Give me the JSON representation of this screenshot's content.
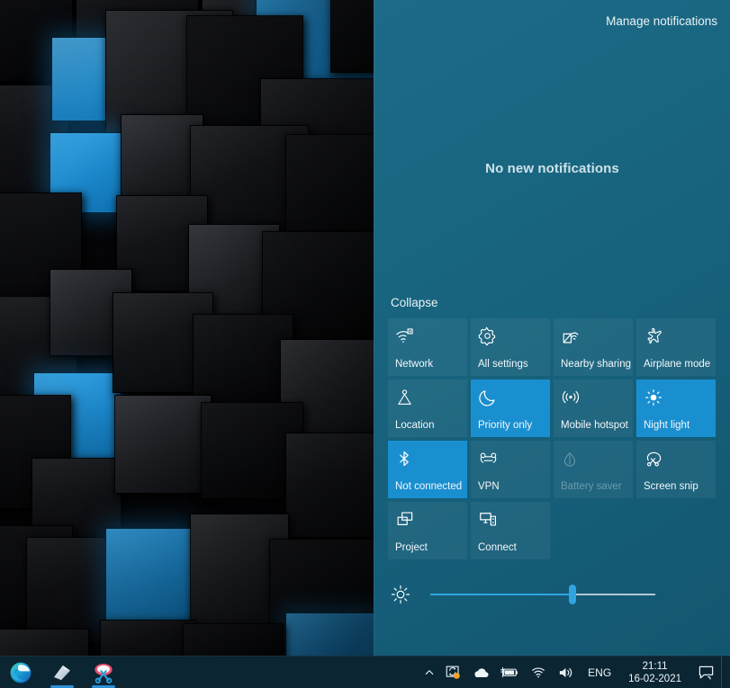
{
  "desktop": {
    "wallpaper_name": "dark-blue-cubes-wallpaper",
    "colors": {
      "cube_dark": "#131418",
      "cube_blue": "#1b86c9",
      "background": "#050507"
    }
  },
  "action_center": {
    "manage_notifications_label": "Manage notifications",
    "empty_state_text": "No new notifications",
    "collapse_label": "Collapse",
    "colors": {
      "panel_background": "#18657f",
      "tile_inactive": "#2d6d86",
      "tile_active_accent": "#1a8fd0",
      "text": "#f2f8fb"
    },
    "tiles": [
      {
        "label": "Network",
        "icon": "network-wifi-icon",
        "state": "off"
      },
      {
        "label": "All settings",
        "icon": "gear-icon",
        "state": "off"
      },
      {
        "label": "Nearby sharing",
        "icon": "nearby-sharing-icon",
        "state": "off"
      },
      {
        "label": "Airplane mode",
        "icon": "airplane-icon",
        "state": "off"
      },
      {
        "label": "Location",
        "icon": "location-icon",
        "state": "off"
      },
      {
        "label": "Priority only",
        "icon": "moon-icon",
        "state": "on"
      },
      {
        "label": "Mobile hotspot",
        "icon": "hotspot-icon",
        "state": "off"
      },
      {
        "label": "Night light",
        "icon": "night-light-sun-icon",
        "state": "on"
      },
      {
        "label": "Not connected",
        "icon": "bluetooth-icon",
        "state": "on"
      },
      {
        "label": "VPN",
        "icon": "vpn-icon",
        "state": "off"
      },
      {
        "label": "Battery saver",
        "icon": "battery-saver-icon",
        "state": "disabled"
      },
      {
        "label": "Screen snip",
        "icon": "screen-snip-icon",
        "state": "off"
      },
      {
        "label": "Project",
        "icon": "project-icon",
        "state": "off"
      },
      {
        "label": "Connect",
        "icon": "connect-icon",
        "state": "off"
      }
    ],
    "brightness": {
      "icon": "brightness-sun-icon",
      "value_percent": 63,
      "min": 0,
      "max": 100
    }
  },
  "taskbar": {
    "apps": [
      {
        "name": "microsoft-edge",
        "icon": "edge-icon",
        "running": false
      },
      {
        "name": "sticky-notes",
        "icon": "sticky-notes-icon",
        "running": true
      },
      {
        "name": "snip-and-sketch",
        "icon": "snip-sketch-icon",
        "running": true
      }
    ],
    "tray": {
      "show_hidden_icons": "chevron-up-icon",
      "icons": [
        {
          "name": "photos-sync-icon",
          "badge": true
        },
        {
          "name": "onedrive-cloud-icon",
          "badge": false
        },
        {
          "name": "battery-charging-icon",
          "badge": false
        },
        {
          "name": "wifi-icon",
          "badge": false
        },
        {
          "name": "volume-speaker-icon",
          "badge": false
        }
      ],
      "language": "ENG",
      "clock_time": "21:11",
      "clock_date": "16-02-2021",
      "action_center_icon": "action-center-bubble-icon"
    }
  }
}
